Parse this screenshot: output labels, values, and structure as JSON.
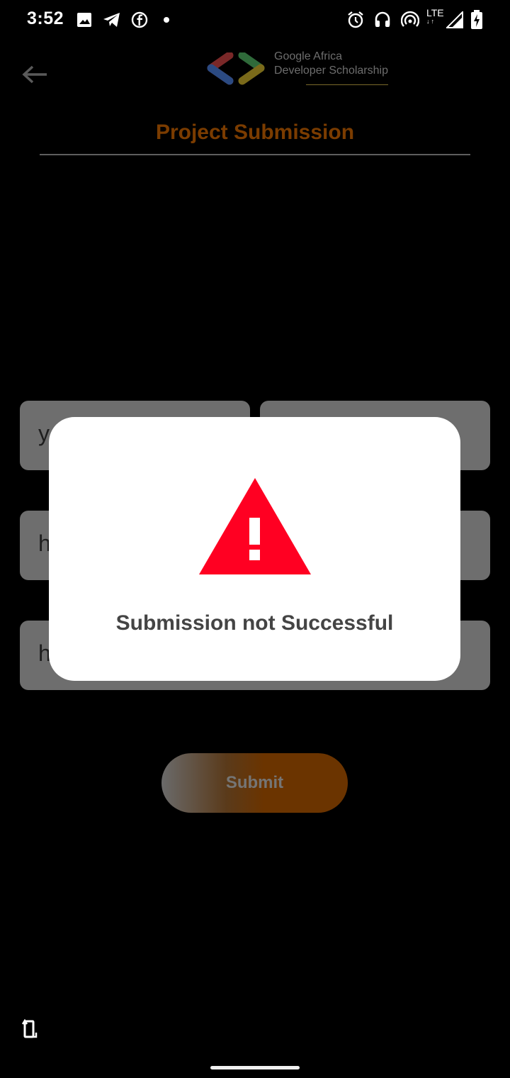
{
  "status_bar": {
    "time": "3:52",
    "network": "LTE",
    "icons": [
      "image-icon",
      "telegram-icon",
      "facebook-icon",
      "dot-icon",
      "alarm-icon",
      "headset-icon",
      "hotspot-icon",
      "signal-icon",
      "battery-charging-icon"
    ]
  },
  "header": {
    "back_icon": "arrow-left-icon",
    "brand_line1": "Google Africa",
    "brand_line2": "Developer Scholarship",
    "title": "Project Submission"
  },
  "form": {
    "fields": [
      {
        "value": "y"
      },
      {
        "value": ""
      },
      {
        "value": "h"
      },
      {
        "value": "h"
      }
    ],
    "submit_label": "Submit"
  },
  "dialog": {
    "icon": "warning-triangle-icon",
    "message": "Submission not Successful"
  },
  "nav": {
    "rotate_icon": "screen-rotate-icon"
  },
  "colors": {
    "title": "#7b3c00",
    "warning": "#ff0022",
    "dialog_bg": "#ffffff",
    "submit_accent": "#6b3400"
  }
}
